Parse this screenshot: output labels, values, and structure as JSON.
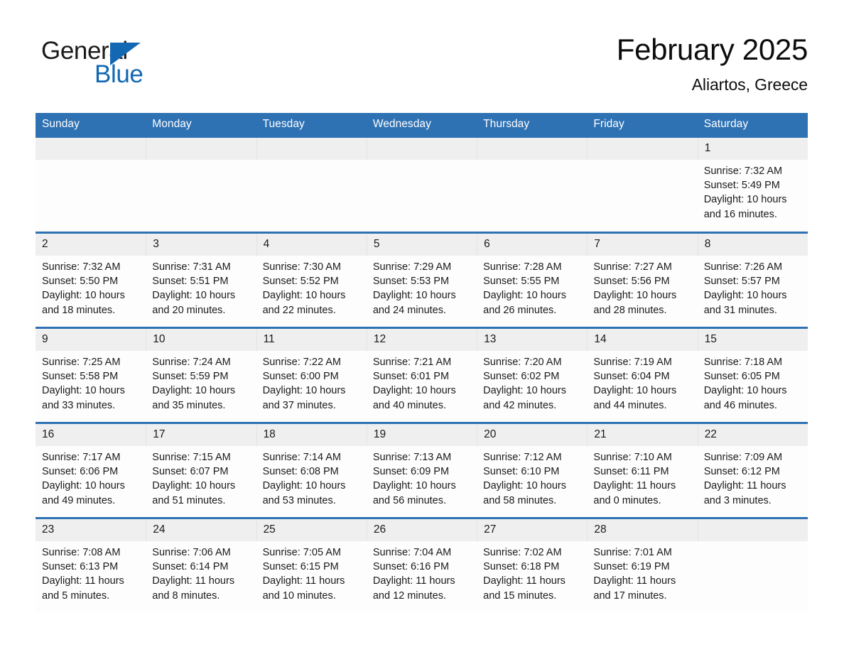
{
  "brand": {
    "name_part1": "General",
    "name_part2": "Blue",
    "triangle_icon": "triangle-logo-icon"
  },
  "header": {
    "title": "February 2025",
    "location": "Aliartos, Greece"
  },
  "theme": {
    "accent_blue": "#2e72b4",
    "brand_blue": "#1368b3",
    "daynum_band": "#efefef",
    "cell_background": "#fdfdfd",
    "text": "#1a1a1a"
  },
  "weekday_headers": [
    "Sunday",
    "Monday",
    "Tuesday",
    "Wednesday",
    "Thursday",
    "Friday",
    "Saturday"
  ],
  "labels": {
    "sunrise_prefix": "Sunrise:",
    "sunset_prefix": "Sunset:",
    "daylight_prefix": "Daylight:"
  },
  "weeks": [
    [
      {
        "day": "",
        "empty": true
      },
      {
        "day": "",
        "empty": true
      },
      {
        "day": "",
        "empty": true
      },
      {
        "day": "",
        "empty": true
      },
      {
        "day": "",
        "empty": true
      },
      {
        "day": "",
        "empty": true
      },
      {
        "day": "1",
        "sunrise": "Sunrise: 7:32 AM",
        "sunset": "Sunset: 5:49 PM",
        "daylight": "Daylight: 10 hours and 16 minutes."
      }
    ],
    [
      {
        "day": "2",
        "sunrise": "Sunrise: 7:32 AM",
        "sunset": "Sunset: 5:50 PM",
        "daylight": "Daylight: 10 hours and 18 minutes."
      },
      {
        "day": "3",
        "sunrise": "Sunrise: 7:31 AM",
        "sunset": "Sunset: 5:51 PM",
        "daylight": "Daylight: 10 hours and 20 minutes."
      },
      {
        "day": "4",
        "sunrise": "Sunrise: 7:30 AM",
        "sunset": "Sunset: 5:52 PM",
        "daylight": "Daylight: 10 hours and 22 minutes."
      },
      {
        "day": "5",
        "sunrise": "Sunrise: 7:29 AM",
        "sunset": "Sunset: 5:53 PM",
        "daylight": "Daylight: 10 hours and 24 minutes."
      },
      {
        "day": "6",
        "sunrise": "Sunrise: 7:28 AM",
        "sunset": "Sunset: 5:55 PM",
        "daylight": "Daylight: 10 hours and 26 minutes."
      },
      {
        "day": "7",
        "sunrise": "Sunrise: 7:27 AM",
        "sunset": "Sunset: 5:56 PM",
        "daylight": "Daylight: 10 hours and 28 minutes."
      },
      {
        "day": "8",
        "sunrise": "Sunrise: 7:26 AM",
        "sunset": "Sunset: 5:57 PM",
        "daylight": "Daylight: 10 hours and 31 minutes."
      }
    ],
    [
      {
        "day": "9",
        "sunrise": "Sunrise: 7:25 AM",
        "sunset": "Sunset: 5:58 PM",
        "daylight": "Daylight: 10 hours and 33 minutes."
      },
      {
        "day": "10",
        "sunrise": "Sunrise: 7:24 AM",
        "sunset": "Sunset: 5:59 PM",
        "daylight": "Daylight: 10 hours and 35 minutes."
      },
      {
        "day": "11",
        "sunrise": "Sunrise: 7:22 AM",
        "sunset": "Sunset: 6:00 PM",
        "daylight": "Daylight: 10 hours and 37 minutes."
      },
      {
        "day": "12",
        "sunrise": "Sunrise: 7:21 AM",
        "sunset": "Sunset: 6:01 PM",
        "daylight": "Daylight: 10 hours and 40 minutes."
      },
      {
        "day": "13",
        "sunrise": "Sunrise: 7:20 AM",
        "sunset": "Sunset: 6:02 PM",
        "daylight": "Daylight: 10 hours and 42 minutes."
      },
      {
        "day": "14",
        "sunrise": "Sunrise: 7:19 AM",
        "sunset": "Sunset: 6:04 PM",
        "daylight": "Daylight: 10 hours and 44 minutes."
      },
      {
        "day": "15",
        "sunrise": "Sunrise: 7:18 AM",
        "sunset": "Sunset: 6:05 PM",
        "daylight": "Daylight: 10 hours and 46 minutes."
      }
    ],
    [
      {
        "day": "16",
        "sunrise": "Sunrise: 7:17 AM",
        "sunset": "Sunset: 6:06 PM",
        "daylight": "Daylight: 10 hours and 49 minutes."
      },
      {
        "day": "17",
        "sunrise": "Sunrise: 7:15 AM",
        "sunset": "Sunset: 6:07 PM",
        "daylight": "Daylight: 10 hours and 51 minutes."
      },
      {
        "day": "18",
        "sunrise": "Sunrise: 7:14 AM",
        "sunset": "Sunset: 6:08 PM",
        "daylight": "Daylight: 10 hours and 53 minutes."
      },
      {
        "day": "19",
        "sunrise": "Sunrise: 7:13 AM",
        "sunset": "Sunset: 6:09 PM",
        "daylight": "Daylight: 10 hours and 56 minutes."
      },
      {
        "day": "20",
        "sunrise": "Sunrise: 7:12 AM",
        "sunset": "Sunset: 6:10 PM",
        "daylight": "Daylight: 10 hours and 58 minutes."
      },
      {
        "day": "21",
        "sunrise": "Sunrise: 7:10 AM",
        "sunset": "Sunset: 6:11 PM",
        "daylight": "Daylight: 11 hours and 0 minutes."
      },
      {
        "day": "22",
        "sunrise": "Sunrise: 7:09 AM",
        "sunset": "Sunset: 6:12 PM",
        "daylight": "Daylight: 11 hours and 3 minutes."
      }
    ],
    [
      {
        "day": "23",
        "sunrise": "Sunrise: 7:08 AM",
        "sunset": "Sunset: 6:13 PM",
        "daylight": "Daylight: 11 hours and 5 minutes."
      },
      {
        "day": "24",
        "sunrise": "Sunrise: 7:06 AM",
        "sunset": "Sunset: 6:14 PM",
        "daylight": "Daylight: 11 hours and 8 minutes."
      },
      {
        "day": "25",
        "sunrise": "Sunrise: 7:05 AM",
        "sunset": "Sunset: 6:15 PM",
        "daylight": "Daylight: 11 hours and 10 minutes."
      },
      {
        "day": "26",
        "sunrise": "Sunrise: 7:04 AM",
        "sunset": "Sunset: 6:16 PM",
        "daylight": "Daylight: 11 hours and 12 minutes."
      },
      {
        "day": "27",
        "sunrise": "Sunrise: 7:02 AM",
        "sunset": "Sunset: 6:18 PM",
        "daylight": "Daylight: 11 hours and 15 minutes."
      },
      {
        "day": "28",
        "sunrise": "Sunrise: 7:01 AM",
        "sunset": "Sunset: 6:19 PM",
        "daylight": "Daylight: 11 hours and 17 minutes."
      },
      {
        "day": "",
        "empty": true
      }
    ]
  ]
}
